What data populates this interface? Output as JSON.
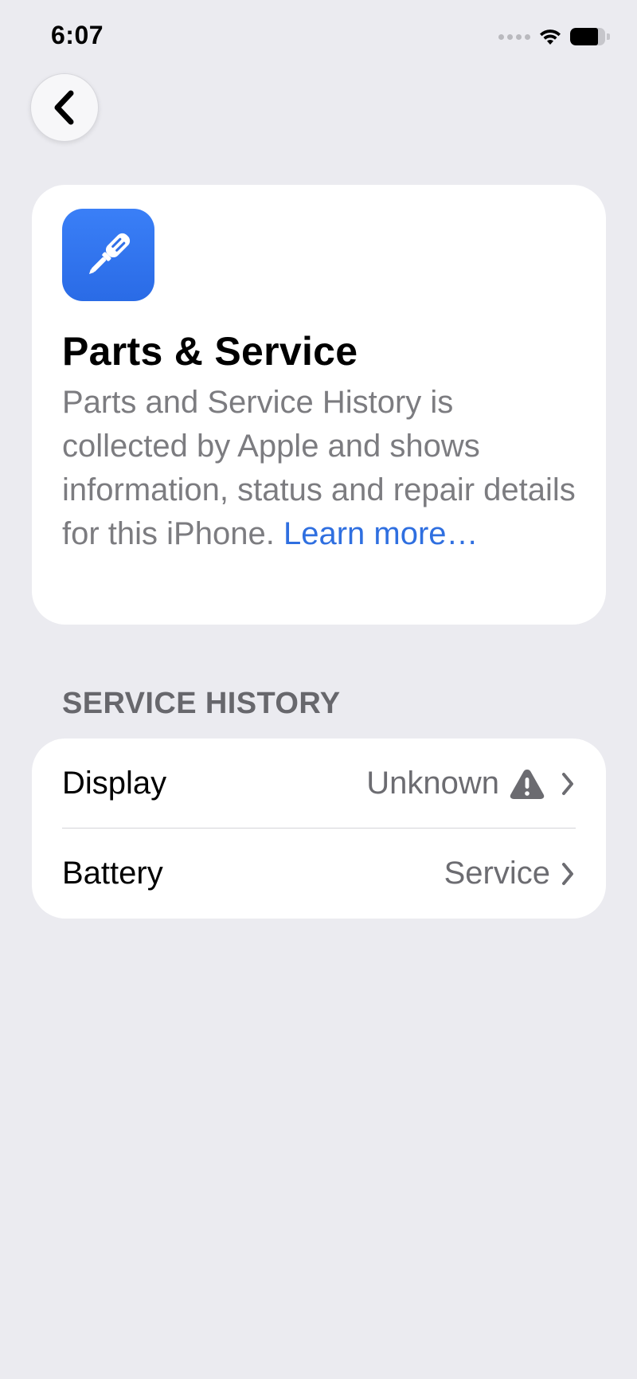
{
  "status_bar": {
    "time": "6:07",
    "icons": [
      "signal-dots-icon",
      "wifi-icon",
      "battery-icon"
    ]
  },
  "nav": {
    "back_icon": "chevron-left-icon"
  },
  "info_card": {
    "app_icon": "screwdriver-icon",
    "app_icon_color": "#2f6fe8",
    "title": "Parts & Service",
    "description": "Parts and Service History is collected by Apple and shows information, status and repair details for this iPhone.",
    "link_text": "Learn more…",
    "link_color": "#2f6fe0"
  },
  "service_history": {
    "header": "SERVICE HISTORY",
    "rows": [
      {
        "label": "Display",
        "value": "Unknown",
        "status_icon": "warning-triangle-icon"
      },
      {
        "label": "Battery",
        "value": "Service",
        "status_icon": ""
      }
    ]
  }
}
